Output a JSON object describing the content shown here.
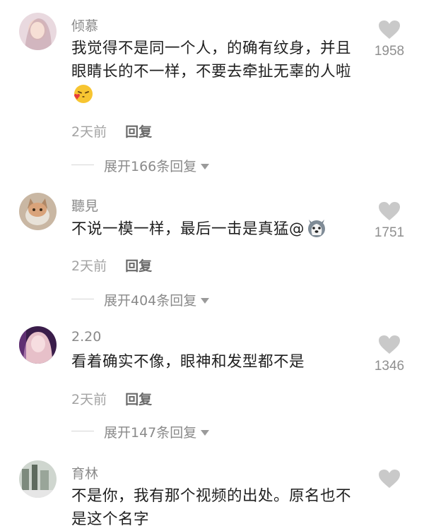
{
  "colors": {
    "username": "#8a8a8a",
    "text": "#1f1f1f",
    "meta": "#a3a3a3",
    "heart": "#c9c9c9"
  },
  "comments": [
    {
      "username": "倾慕",
      "text": "我觉得不是同一个人，的确有纹身，并且眼睛长的不一样，不要去牵扯无辜的人啦",
      "emoji": "kissing-face-emoji",
      "time": "2天前",
      "reply_label": "回复",
      "likes": "1958",
      "expand_label": "展开166条回复"
    },
    {
      "username": "聽見",
      "text": "不说一模一样，最后一击是真猛@",
      "emoji": "husky-emoji",
      "time": "2天前",
      "reply_label": "回复",
      "likes": "1751",
      "expand_label": "展开404条回复"
    },
    {
      "username": "2.20",
      "text": "看着确实不像，眼神和发型都不是",
      "time": "2天前",
      "reply_label": "回复",
      "likes": "1346",
      "expand_label": "展开147条回复"
    },
    {
      "username": "育林",
      "text": "不是你，我有那个视频的出处。原名也不是这个名字"
    }
  ]
}
